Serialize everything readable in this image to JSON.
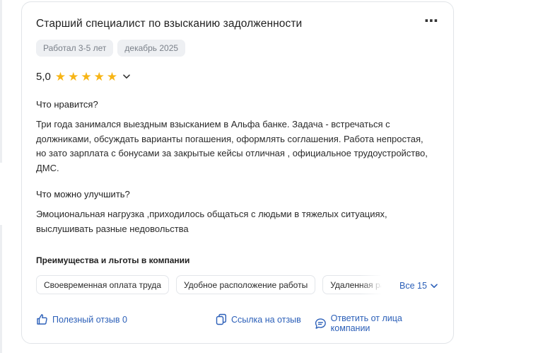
{
  "review": {
    "title": "Старший специалист по взысканию задолженности",
    "more_icon": "⋯",
    "tags": [
      "Работал 3-5 лет",
      "декабрь 2025"
    ],
    "rating": {
      "value": "5,0",
      "stars": 5,
      "max_stars": 5
    },
    "likes": {
      "title": "Что нравится?",
      "text": "Три года занимался выездным взысканием в Альфа банке. Задача - встречаться с должниками, обсуждать варианты погашения, оформлять соглашения. Работа непростая, но зато зарплата с бонусами за закрытые кейсы отличная , официальное трудоустройство, ДМС."
    },
    "improve": {
      "title": "Что можно улучшить?",
      "text": "Эмоциональная нагрузка ,приходилось общаться с людьми в тяжелых ситуациях, выслушивать разные недовольства"
    },
    "benefits": {
      "title": "Преимущества и льготы в компании",
      "items": [
        "Своевременная оплата труда",
        "Удобное расположение работы",
        "Удаленная работа"
      ],
      "show_all": "Все 15"
    },
    "actions": {
      "helpful": "Полезный отзыв 0",
      "link": "Ссылка на отзыв",
      "reply": "Ответить от лица компании"
    }
  },
  "colors": {
    "star": "#f7b516",
    "link": "#2b5fb8",
    "tag_bg": "#eef0f3",
    "border": "#e1e4e8"
  }
}
